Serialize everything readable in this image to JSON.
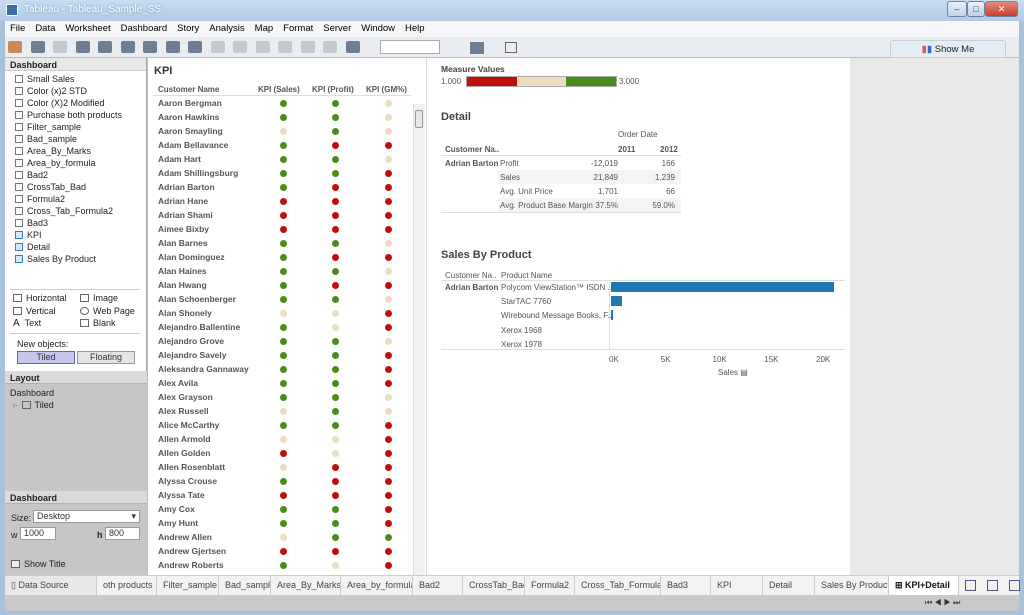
{
  "window": {
    "title": "Tableau - Tableau_Sample_SS"
  },
  "menu": [
    "File",
    "Data",
    "Worksheet",
    "Dashboard",
    "Story",
    "Analysis",
    "Map",
    "Format",
    "Server",
    "Window",
    "Help"
  ],
  "toolbar": {
    "show_me": "Show Me"
  },
  "left_panel": {
    "dashboard_header": "Dashboard",
    "sheets": [
      {
        "label": "Small Sales",
        "used": false
      },
      {
        "label": "Color (x)2 STD",
        "used": false
      },
      {
        "label": "Color (X)2 Modified",
        "used": false
      },
      {
        "label": "Purchase both products",
        "used": false
      },
      {
        "label": "Filter_sample",
        "used": false
      },
      {
        "label": "Bad_sample",
        "used": false
      },
      {
        "label": "Area_By_Marks",
        "used": false
      },
      {
        "label": "Area_by_formula",
        "used": false
      },
      {
        "label": "Bad2",
        "used": false
      },
      {
        "label": "CrossTab_Bad",
        "used": false
      },
      {
        "label": "Formula2",
        "used": false
      },
      {
        "label": "Cross_Tab_Formula2",
        "used": false
      },
      {
        "label": "Bad3",
        "used": false
      },
      {
        "label": "KPI",
        "used": true
      },
      {
        "label": "Detail",
        "used": true
      },
      {
        "label": "Sales By Product",
        "used": true
      }
    ],
    "objects": {
      "horizontal": "Horizontal",
      "image": "Image",
      "vertical": "Vertical",
      "web_page": "Web Page",
      "text": "Text",
      "blank": "Blank"
    },
    "new_objects_label": "New objects:",
    "tiled": "Tiled",
    "floating": "Floating",
    "layout_header": "Layout",
    "layout_root": "Dashboard",
    "layout_child": "Tiled",
    "dashboard_settings_header": "Dashboard",
    "size_label": "Size:",
    "size_value": "Desktop",
    "w_label": "w",
    "w_value": "1000",
    "h_label": "h",
    "h_value": "800",
    "show_title": "Show Title"
  },
  "kpi": {
    "title": "KPI",
    "headers": [
      "Customer Name",
      "KPI (Sales)",
      "KPI (Profit)",
      "KPI (GM%)"
    ],
    "colors": {
      "G": "#4a8c1c",
      "R": "#c00f0b",
      "T": "#ecdcc0"
    },
    "rows": [
      [
        "Aaron Bergman",
        "GGT"
      ],
      [
        "Aaron Hawkins",
        "GGT"
      ],
      [
        "Aaron Smayling",
        "TGT"
      ],
      [
        "Adam Bellavance",
        "GRR"
      ],
      [
        "Adam Hart",
        "GGT"
      ],
      [
        "Adam Shillingsburg",
        "GGR"
      ],
      [
        "Adrian Barton",
        "GRR"
      ],
      [
        "Adrian Hane",
        "RRR"
      ],
      [
        "Adrian Shami",
        "RRR"
      ],
      [
        "Aimee Bixby",
        "RRR"
      ],
      [
        "Alan Barnes",
        "GGT"
      ],
      [
        "Alan Dominguez",
        "GRR"
      ],
      [
        "Alan Haines",
        "GGT"
      ],
      [
        "Alan Hwang",
        "GRR"
      ],
      [
        "Alan Schoenberger",
        "GGT"
      ],
      [
        "Alan Shonely",
        "TTR"
      ],
      [
        "Alejandro Ballentine",
        "GTR"
      ],
      [
        "Alejandro Grove",
        "GGT"
      ],
      [
        "Alejandro Savely",
        "GGR"
      ],
      [
        "Aleksandra Gannaway",
        "GGR"
      ],
      [
        "Alex Avila",
        "GGR"
      ],
      [
        "Alex Grayson",
        "GGT"
      ],
      [
        "Alex Russell",
        "TGT"
      ],
      [
        "Alice McCarthy",
        "GGR"
      ],
      [
        "Allen Armold",
        "TTR"
      ],
      [
        "Allen Golden",
        "RTR"
      ],
      [
        "Allen Rosenblatt",
        "TRR"
      ],
      [
        "Alyssa Crouse",
        "GRR"
      ],
      [
        "Alyssa Tate",
        "RRR"
      ],
      [
        "Amy Cox",
        "GGR"
      ],
      [
        "Amy Hunt",
        "GGR"
      ],
      [
        "Andrew Allen",
        "TGG"
      ],
      [
        "Andrew Gjertsen",
        "RRR"
      ],
      [
        "Andrew Roberts",
        "GTR"
      ]
    ]
  },
  "legend": {
    "title": "Measure Values",
    "min": "1.000",
    "max": "3.000",
    "colors": [
      "#c00f0b",
      "#ecdcc0",
      "#4a8c1c"
    ]
  },
  "detail": {
    "title": "Detail",
    "col_group": "Order Date",
    "row_header": "Customer Na..",
    "years": [
      "2011",
      "2012"
    ],
    "customer": "Adrian Barton",
    "rows": [
      [
        "Profit",
        "-12,019",
        "166"
      ],
      [
        "Sales",
        "21,849",
        "1,239"
      ],
      [
        "Avg. Unit Price",
        "1,701",
        "66"
      ],
      [
        "Avg. Product Base Margin",
        "37.5%",
        "59.0%"
      ]
    ]
  },
  "chart_data": {
    "type": "bar",
    "title": "Sales By Product",
    "row_headers": [
      "Customer Na..",
      "Product Name"
    ],
    "customer": "Adrian Barton",
    "categories": [
      "Polycom ViewStation™ ISDN ...",
      "StarTAC 7760",
      "Wirebound Message Books, F...",
      "Xerox 1968",
      "Xerox 1978"
    ],
    "values": [
      21500,
      1100,
      200,
      20,
      15
    ],
    "xlabel": "Sales",
    "xlim": [
      0,
      22500
    ],
    "ticks": [
      "0K",
      "5K",
      "10K",
      "15K",
      "20K"
    ],
    "tick_values": [
      0,
      5000,
      10000,
      15000,
      20000
    ],
    "color": "#1f77b4"
  },
  "tabs": {
    "data_source": "Data Source",
    "sheets": [
      "oth products",
      "Filter_sample",
      "Bad_sample",
      "Area_By_Marks",
      "Area_by_formula",
      "Bad2",
      "CrossTab_Bad",
      "Formula2",
      "Cross_Tab_Formula2",
      "Bad3",
      "KPI",
      "Detail",
      "Sales By Product",
      "KPI+Detail"
    ],
    "active": "KPI+Detail"
  }
}
